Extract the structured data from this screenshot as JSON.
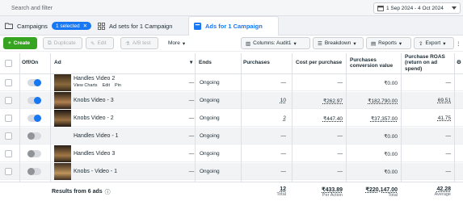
{
  "search": {
    "placeholder": "Search and filter",
    "icon": "search-icon"
  },
  "date_range": {
    "label": "1 Sep 2024 - 4 Oct 2024"
  },
  "tabs": [
    {
      "label": "Campaigns",
      "badge": "1 selected"
    },
    {
      "label": "Ad sets for 1 Campaign"
    },
    {
      "label": "Ads for 1 Campaign"
    }
  ],
  "toolbar": {
    "create": "Create",
    "duplicate": "Duplicate",
    "edit": "Edit",
    "ab_test": "A/B test",
    "more": "More",
    "columns": "Columns: Audit1",
    "breakdown": "Breakdown",
    "reports": "Reports",
    "export": "Export"
  },
  "columns": [
    "Off/On",
    "Ad",
    "Ends",
    "Purchases",
    "Cost per purchase",
    "Purchases conversion value",
    "Purchase ROAS (return on ad spend)"
  ],
  "rows": [
    {
      "on": true,
      "name": "Handles Video 2",
      "ends": "Ongoing",
      "purchases": "—",
      "cost": "—",
      "conv_value": "₹0.00",
      "roas": "—",
      "show_actions": true
    },
    {
      "on": true,
      "name": "Knobs Video - 3",
      "ends": "Ongoing",
      "purchases": "10",
      "cost": "₹262.97",
      "conv_value": "₹182,790.00",
      "roas": "69.51",
      "show_actions": false
    },
    {
      "on": true,
      "name": "Knobs Video - 2",
      "ends": "Ongoing",
      "purchases": "2",
      "cost": "₹447.40",
      "conv_value": "₹37,357.00",
      "roas": "41.75",
      "show_actions": false
    },
    {
      "on": false,
      "name": "Handles Video - 1",
      "ends": "Ongoing",
      "purchases": "—",
      "cost": "—",
      "conv_value": "₹0.00",
      "roas": "—",
      "show_actions": false
    },
    {
      "on": false,
      "name": "Handles Video 3",
      "ends": "Ongoing",
      "purchases": "—",
      "cost": "—",
      "conv_value": "₹0.00",
      "roas": "—",
      "show_actions": false
    },
    {
      "on": false,
      "name": "Knobs - Video - 1",
      "ends": "Ongoing",
      "purchases": "—",
      "cost": "—",
      "conv_value": "₹0.00",
      "roas": "—",
      "show_actions": false
    }
  ],
  "row_actions": {
    "view_charts": "View Charts",
    "edit": "Edit",
    "pin": "Pin"
  },
  "dash": "—",
  "footer": {
    "label": "Results from 6 ads",
    "purchases": "12",
    "purchases_sub": "Total",
    "cost": "₹433.89",
    "cost_sub": "Per Action",
    "conv_value": "₹220,147.00",
    "conv_value_sub": "Total",
    "roas": "42.28",
    "roas_sub": "Average"
  },
  "colors": {
    "accent": "#1877f2",
    "create_green": "#36a420",
    "toggle_on": "#1877f2"
  }
}
